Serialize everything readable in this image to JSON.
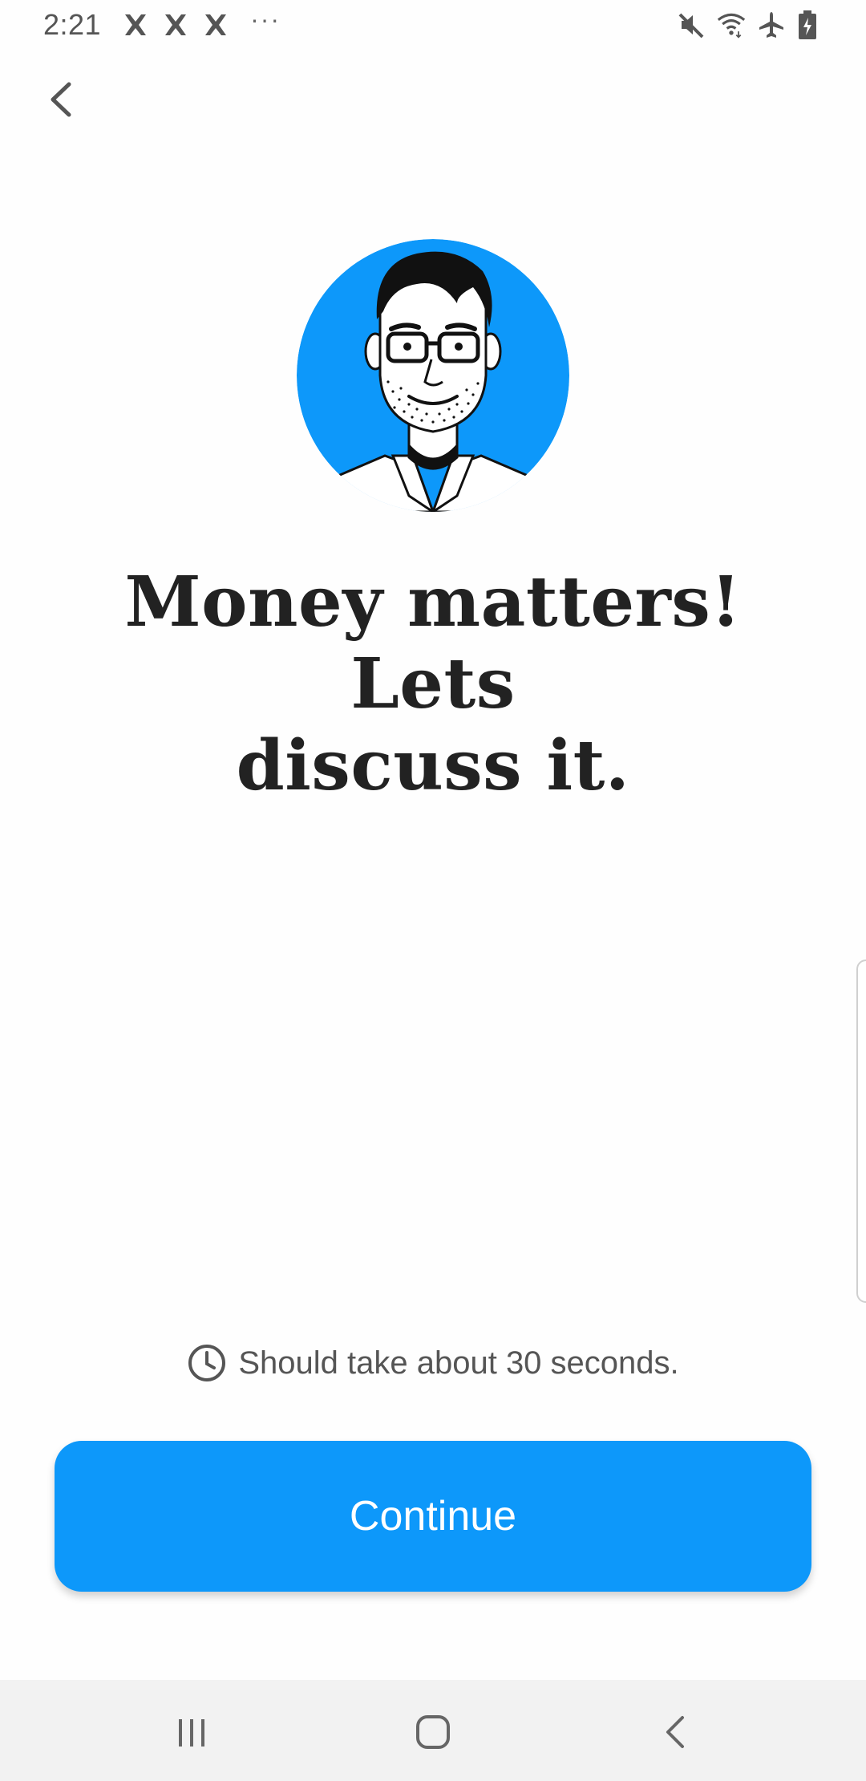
{
  "status_bar": {
    "time": "2:21",
    "dots": "···",
    "notification_icons": [
      "x-app-icon",
      "x-app-icon",
      "x-app-icon"
    ],
    "right_icons": [
      "mute-icon",
      "wifi-icon",
      "airplane-icon",
      "battery-icon"
    ]
  },
  "nav": {
    "back_icon": "chevron-left-icon"
  },
  "avatar": {
    "icon": "man-with-glasses-illustration",
    "background_color": "#0d98fa"
  },
  "heading": {
    "line1": "Money matters! Lets",
    "line2": "discuss it."
  },
  "duration": {
    "icon": "clock-icon",
    "text": "Should take about 30 seconds."
  },
  "continue_button": {
    "label": "Continue",
    "color": "#0d98fa"
  },
  "system_nav": {
    "buttons": [
      "recents-icon",
      "home-icon",
      "back-icon"
    ]
  }
}
